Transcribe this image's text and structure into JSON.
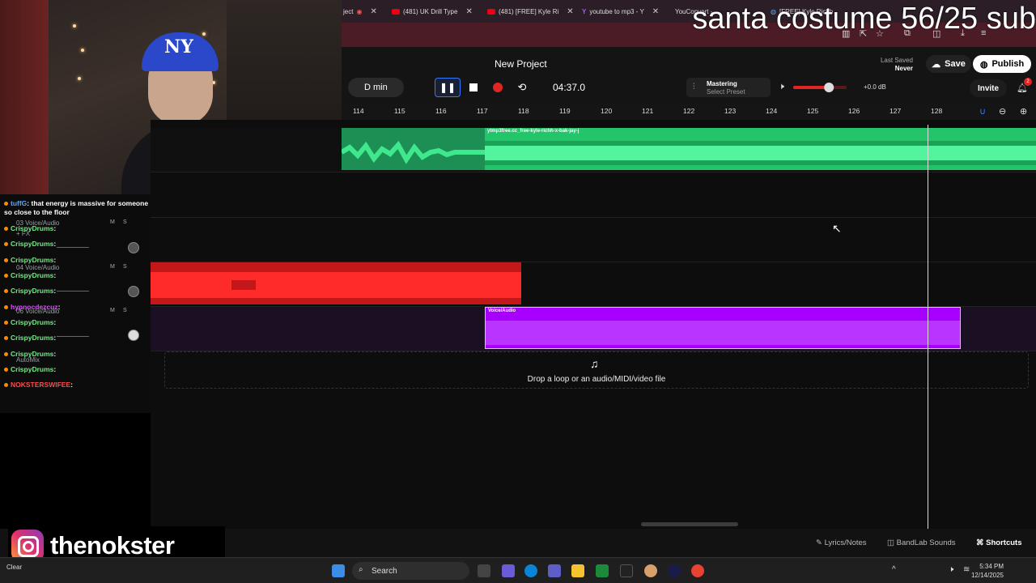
{
  "stream_overlay": {
    "title": "santa costume 56/25 sub",
    "instagram_handle": "thenokster"
  },
  "webcam": {
    "cap_logo": "NY"
  },
  "chat": {
    "messages": [
      {
        "user": "tuffG",
        "text": ": that energy is massive for someone so close to the floor"
      },
      {
        "user": "CrispyDrums",
        "text": ":"
      },
      {
        "user": "CrispyDrums",
        "text": ":"
      },
      {
        "user": "CrispyDrums",
        "text": ":"
      },
      {
        "user": "CrispyDrums",
        "text": ":"
      },
      {
        "user": "CrispyDrums",
        "text": ":"
      },
      {
        "user": "hypnocdezcuz",
        "text": ":"
      },
      {
        "user": "CrispyDrums",
        "text": ":"
      },
      {
        "user": "CrispyDrums",
        "text": ":"
      },
      {
        "user": "CrispyDrums",
        "text": ":"
      },
      {
        "user": "CrispyDrums",
        "text": ":"
      },
      {
        "user": "NOKSTERSWIFEE",
        "text": ":"
      }
    ],
    "ghost_tracks": [
      "03 Voice/Audio",
      "04 Voice/Audio",
      "06 Voice/Audio",
      "AutoMix"
    ],
    "ghost_fx": "+ FX",
    "mute_label": "M",
    "solo_label": "S"
  },
  "browser": {
    "tabs": [
      {
        "label": "ject",
        "icon": "studio"
      },
      {
        "label": "(481) UK Drill Type",
        "icon": "youtube"
      },
      {
        "label": "(481) [FREE] Kyle Ri",
        "icon": "youtube"
      },
      {
        "label": "youtube to mp3 - Y",
        "icon": "yahoo"
      },
      {
        "label": "YouConvert - ...",
        "icon": "convert"
      },
      {
        "label": "[FREE] Kyle Richh",
        "icon": "web"
      }
    ]
  },
  "header": {
    "project_name": "New Project",
    "last_saved_label": "Last Saved",
    "last_saved_value": "Never",
    "save_label": "Save",
    "publish_label": "Publish",
    "invite_label": "Invite",
    "notification_count": "2",
    "key": "D min",
    "time": "04:37.0",
    "mastering_label": "Mastering",
    "mastering_preset": "Select Preset",
    "volume_db": "+0.0 dB",
    "volume_level": 0.67
  },
  "ruler": {
    "bars": [
      "114",
      "115",
      "116",
      "117",
      "118",
      "119",
      "120",
      "121",
      "122",
      "123",
      "124",
      "125",
      "126",
      "127",
      "128"
    ]
  },
  "clips": {
    "green_label": "ytmp3free.cc_free-kyle-richh-x-bak-jay-j",
    "purple_label": "Voice/Audio"
  },
  "dropzone": {
    "text": "Drop a loop or an audio/MIDI/video file"
  },
  "bottom_bar": {
    "lyrics_label": "Lyrics/Notes",
    "sounds_label": "BandLab Sounds",
    "shortcuts_label": "Shortcuts"
  },
  "taskbar": {
    "search_placeholder": "Search",
    "time": "5:34 PM",
    "date": "12/14/2025",
    "weather": "Clear"
  },
  "colors": {
    "green_clip": "#22c56a",
    "red_clip": "#e0201e",
    "purple_clip": "#a800ff",
    "accent": "#2f7bff"
  }
}
